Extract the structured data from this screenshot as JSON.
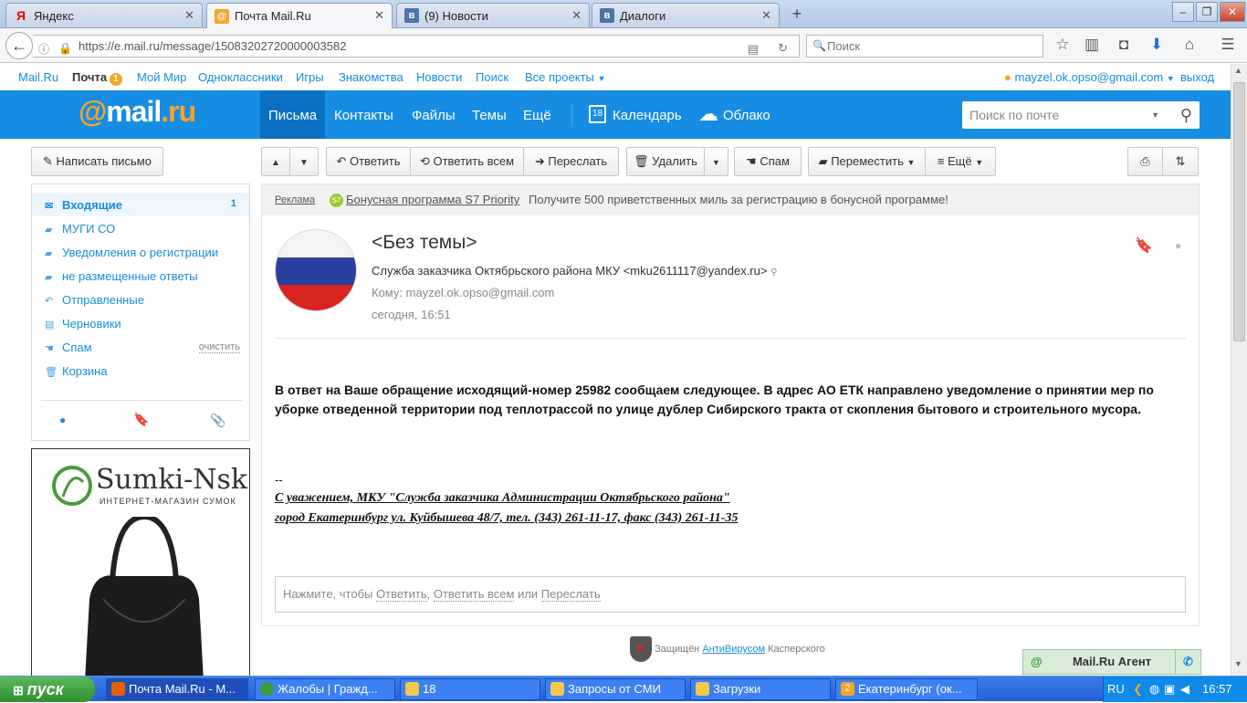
{
  "browser": {
    "tabs": [
      {
        "title": "Яндекс",
        "icon": "yandex-icon",
        "close": "✕"
      },
      {
        "title": "Почта Mail.Ru",
        "icon": "mailru-icon",
        "close": "✕"
      },
      {
        "title": "(9) Новости",
        "icon": "vk-icon",
        "close": "✕"
      },
      {
        "title": "Диалоги",
        "icon": "vk-icon",
        "close": "✕"
      }
    ],
    "url": "https://e.mail.ru/message/15083202720000003582",
    "search_placeholder": "Поиск"
  },
  "toplinks": {
    "mailru": "Mail.Ru",
    "pochta": "Почта",
    "pochta_count": "1",
    "moymir": "Мой Мир",
    "ok": "Одноклассники",
    "games": "Игры",
    "dating": "Знакомства",
    "news": "Новости",
    "search": "Поиск",
    "all": "Все проекты",
    "user": "mayzel.ok.opso@gmail.com",
    "exit": "выход"
  },
  "header": {
    "logo_at": "@",
    "logo_mail": "mail",
    "logo_ru": ".ru",
    "nav": [
      "Письма",
      "Контакты",
      "Файлы",
      "Темы",
      "Ещё"
    ],
    "calendar": "Календарь",
    "calendar_day": "18",
    "cloud": "Облако",
    "search_placeholder": "Поиск по почте"
  },
  "toolbar": {
    "compose": "Написать письмо",
    "reply": "Ответить",
    "reply_all": "Ответить всем",
    "forward": "Переслать",
    "delete": "Удалить",
    "spam": "Спам",
    "move": "Переместить",
    "more": "Ещё"
  },
  "sidebar": {
    "folders": [
      {
        "label": "Входящие",
        "count": "1"
      },
      {
        "label": "МУГИ СО"
      },
      {
        "label": "Уведомления о регистрации"
      },
      {
        "label": "не размещенные ответы"
      },
      {
        "label": "Отправленные"
      },
      {
        "label": "Черновики"
      },
      {
        "label": "Спам",
        "action": "очистить"
      },
      {
        "label": "Корзина"
      }
    ]
  },
  "ad": {
    "logo": "Sumki-Nsk",
    "sub": "ИНТЕРНЕТ-МАГАЗИН СУМОК"
  },
  "promo": {
    "ad_label": "Реклама",
    "s7": "S7",
    "link": "Бонусная программа S7 Priority",
    "text": "Получите 500 приветственных миль за регистрацию в бонусной программе!"
  },
  "message": {
    "subject": "<Без темы>",
    "from": "Служба заказчика Октябрьского района МКУ <mku2611117@yandex.ru>",
    "to": "Кому: mayzel.ok.opso@gmail.com",
    "date": "сегодня, 16:51",
    "body": "В ответ на Ваше обращение исходящий-номер 25982 сообщаем следующее. В адрес АО ЕТК направлено уведомление о принятии мер по уборке отведенной территории под теплотрассой по улице дублер Сибирского тракта от скопления бытового и строительного мусора.",
    "dash": "--",
    "sig1": "С уважением, МКУ \"Служба заказчика Администрации Октябрьского района\"",
    "sig2": "город Екатеринбург ул. Куйбышева 48/7, тел. (343) 261-11-17, факс (343) 261-11-35"
  },
  "reply_box": {
    "prefix": "Нажмите, чтобы",
    "reply": "Ответить",
    "reply_all": "Ответить всем",
    "or": "или",
    "forward": "Переслать"
  },
  "kaspersky": {
    "prefix": "Защищён",
    "link": "АнтиВирусом",
    "suffix": "Касперского"
  },
  "agent": {
    "label": "Mail.Ru Агент"
  },
  "taskbar": {
    "start": "пуск",
    "items": [
      "Почта Mail.Ru - M...",
      "Жалобы | Гражд...",
      "18",
      "Запросы от СМИ",
      "Загрузки",
      "Екатеринбург (ок..."
    ],
    "lang": "RU",
    "time": "16:57"
  }
}
